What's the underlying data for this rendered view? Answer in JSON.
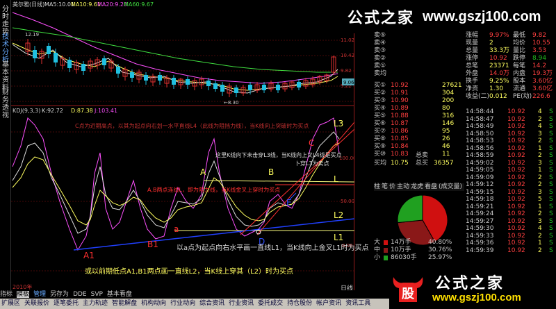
{
  "window": {
    "title": "美尔雅(日线)",
    "ma5": "MA5:10.01",
    "ma10": "MA10:9.61",
    "ma20": "MA20:9.20",
    "ma60": "MA60:9.67"
  },
  "left_tabs": [
    "分时走势",
    "技术分析",
    "基本资料",
    "财务透视"
  ],
  "price_axis": [
    "11.62",
    "11.02",
    "10.42",
    "9.82",
    "9.22",
    "8.62"
  ],
  "price_marker": "9.06",
  "price_high_label": "12.19",
  "price_low_label": "←8.30",
  "kdj_header": {
    "name": "KDJ(9,3,3)",
    "k": "K:92.72",
    "d": "D:87.38",
    "j": "J:103.41"
  },
  "kdj_axis": [
    "100.00",
    "50.00",
    "0.00"
  ],
  "annotations": {
    "c_note": "C点为近期高点，以其为起点向右划一水平直线L4（此线为阻挡力线），当K线向上突破时为买点",
    "k_note": "这里K线向下未击穿L3线，当K线向上叉L4线是买点",
    "l3_note": "卜穿L3为卖点",
    "a_note": "A,B两点连线L，即为阻力线，当K线金叉上穿时为买点",
    "d_note": "以a点为起点向右水平画一直线L1，当K线向上金叉L1时为买点",
    "l2_note": "或以前期低点A1,B1两点画一直线L2，当K线上穿其（L2）时为买点",
    "pts": {
      "A": "A",
      "B": "B",
      "C": "C",
      "D": "D",
      "E": "E",
      "A1": "A1",
      "B1": "B1",
      "a": "a",
      "L": "L",
      "L1": "L1",
      "L2": "L2",
      "L3": "L3"
    }
  },
  "watermark": {
    "cn": "公式之家",
    "url": "www.gszj100.com"
  },
  "quote": {
    "rows": [
      {
        "l": "涨幅",
        "v": "9.97%",
        "l2": "最低",
        "v2": "9.82"
      },
      {
        "l": "现量",
        "v": "2",
        "l2": "均价",
        "v2": "10.55"
      },
      {
        "l": "总量",
        "v": "33.3万",
        "l2": "量比",
        "v2": "3.53"
      },
      {
        "l": "涨停",
        "v": "10.92",
        "l2": "跌停",
        "v2": "8.94"
      },
      {
        "l": "总笔",
        "v": "23371",
        "l2": "每笔",
        "v2": "14.2"
      },
      {
        "l": "外盘",
        "v": "14.0万",
        "l2": "内盘",
        "v2": "19.3万"
      },
      {
        "l": "换手",
        "v": "9.25%",
        "l2": "股本",
        "v2": "3.60亿"
      },
      {
        "l": "净资",
        "v": "1.30",
        "l2": "流通",
        "v2": "3.60亿"
      },
      {
        "l": "收益(二)",
        "v": "0.012",
        "l2": "PE(动)",
        "v2": "226.6"
      }
    ],
    "sells": [
      "卖⑤",
      "卖④",
      "卖③",
      "卖②",
      "卖①"
    ],
    "buys": [
      {
        "l": "买①",
        "p": "10.92",
        "v": "27621"
      },
      {
        "l": "买②",
        "p": "10.91",
        "v": "304"
      },
      {
        "l": "买③",
        "p": "10.90",
        "v": "200"
      },
      {
        "l": "买④",
        "p": "10.89",
        "v": "80"
      },
      {
        "l": "买⑤",
        "p": "10.88",
        "v": "316"
      },
      {
        "l": "买⑥",
        "p": "10.87",
        "v": "146"
      },
      {
        "l": "买⑦",
        "p": "10.86",
        "v": "95"
      },
      {
        "l": "买⑧",
        "p": "10.85",
        "v": "26"
      },
      {
        "l": "买⑨",
        "p": "10.84",
        "v": "46"
      },
      {
        "l": "买⑩",
        "p": "10.83",
        "v": "11"
      }
    ],
    "avg_sell": {
      "l": "卖均",
      "l2": "总卖"
    },
    "avg_buy": {
      "l": "买均",
      "p": "10.75",
      "l2": "总买",
      "v": "36357"
    }
  },
  "ticks": [
    {
      "t": "14:58:44",
      "p": "10.92",
      "v": "4",
      "f": "S"
    },
    {
      "t": "14:58:47",
      "p": "10.92",
      "v": "2",
      "f": "S"
    },
    {
      "t": "14:58:49",
      "p": "10.92",
      "v": "4",
      "f": "S"
    },
    {
      "t": "14:58:50",
      "p": "10.92",
      "v": "3",
      "f": "S"
    },
    {
      "t": "14:58:53",
      "p": "10.92",
      "v": "2",
      "f": "S"
    },
    {
      "t": "14:58:56",
      "p": "10.92",
      "v": "1",
      "f": "S"
    },
    {
      "t": "14:58:59",
      "p": "10.92",
      "v": "2",
      "f": "S"
    },
    {
      "t": "14:59:02",
      "p": "10.92",
      "v": "3",
      "f": "S"
    },
    {
      "t": "14:59:05",
      "p": "10.92",
      "v": "1",
      "f": "S"
    },
    {
      "t": "14:59:09",
      "p": "10.92",
      "v": "2",
      "f": "S"
    },
    {
      "t": "14:59:12",
      "p": "10.92",
      "v": "2",
      "f": "S"
    },
    {
      "t": "14:59:15",
      "p": "10.92",
      "v": "3",
      "f": "S"
    },
    {
      "t": "14:59:18",
      "p": "10.92",
      "v": "5",
      "f": "S"
    },
    {
      "t": "14:59:21",
      "p": "10.92",
      "v": "1",
      "f": "S"
    },
    {
      "t": "14:59:24",
      "p": "10.92",
      "v": "2",
      "f": "S"
    },
    {
      "t": "14:59:27",
      "p": "10.92",
      "v": "3",
      "f": "S"
    },
    {
      "t": "14:59:30",
      "p": "10.92",
      "v": "4",
      "f": "S"
    },
    {
      "t": "14:59:33",
      "p": "10.92",
      "v": "2",
      "f": "S"
    },
    {
      "t": "14:59:36",
      "p": "10.92",
      "v": "1",
      "f": "S"
    },
    {
      "t": "14:59:39",
      "p": "10.92",
      "v": "2",
      "f": "S"
    }
  ],
  "side_tabs": [
    "柱",
    "笔",
    "价",
    "主动",
    "龙虎",
    "看盘",
    "(成交量)",
    "快照",
    "所有"
  ],
  "pie": {
    "rows": [
      {
        "l": "大",
        "tag": "14万手",
        "pct": "40.80%"
      },
      {
        "l": "中",
        "tag": "10万手",
        "pct": "30.76%"
      },
      {
        "l": "小",
        "tag": "86030手",
        "pct": "25.97%"
      }
    ],
    "slices": [
      0.408,
      0.3076,
      0.2597
    ],
    "colors": [
      "#d01010",
      "#8a1818",
      "#20a020"
    ]
  },
  "bottom_logo": {
    "icon": "股",
    "cn": "公式之家",
    "url": "www.gszj100.com"
  },
  "tabbar": [
    "指标",
    "模板",
    "管理",
    "另存为",
    "DDE",
    "SVP",
    "基本看盘"
  ],
  "tabbar_right": "日线",
  "year_label": "2010年",
  "statusbar": [
    "扩展区",
    "关联报价",
    "逐笔委托",
    "主力轨迹",
    "智能解盘",
    "机构动向",
    "行业动向",
    "综合资讯",
    "行业资讯",
    "委托成交",
    "持仓股份",
    "帐户资讯"
  ],
  "statusbar_right": "资讯工具"
}
